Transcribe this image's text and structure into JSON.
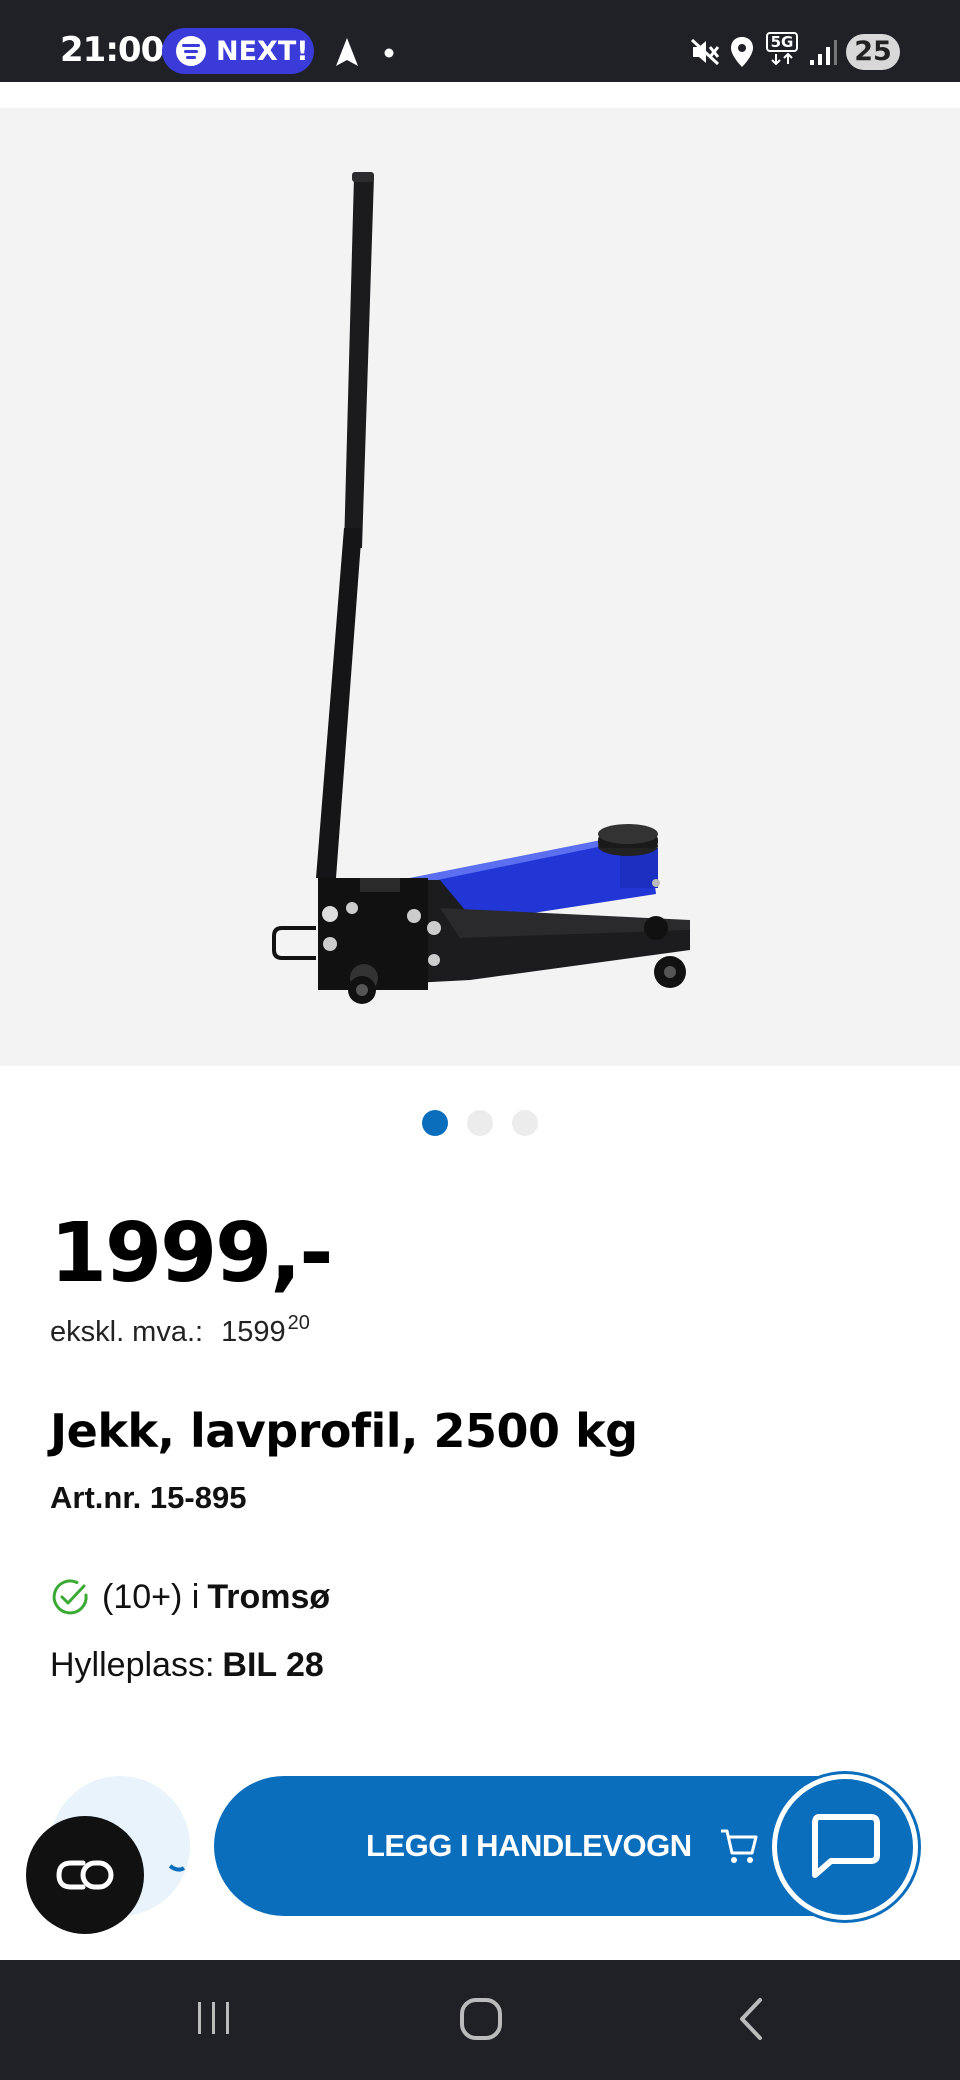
{
  "status_bar": {
    "time": "21:00",
    "music_pill": "NEXT!",
    "network": "5G",
    "battery": "25",
    "icons": [
      "spotify-icon",
      "navigation-icon",
      "dot-icon",
      "mute-icon",
      "location-icon",
      "5g-icon",
      "signal-icon",
      "battery-badge"
    ]
  },
  "gallery": {
    "image_alt": "Jekk, lavprofil, 2500 kg",
    "page_count": 3,
    "active_index": 0
  },
  "product": {
    "price": "1999,-",
    "vat_label": "ekskl. mva.:",
    "vat_whole": "1599",
    "vat_cents": "20",
    "title": "Jekk, lavprofil, 2500 kg",
    "article_number": "Art.nr. 15-895",
    "stock_count": "(10+) i",
    "stock_store": "Tromsø",
    "shelf_label": "Hylleplass:",
    "shelf_value": "BIL 28"
  },
  "actions": {
    "add_to_cart": "LEGG I HANDLEVOGN",
    "icons": [
      "favorite-icon",
      "cart-icon",
      "chat-icon",
      "co-icon"
    ]
  },
  "colors": {
    "accent": "#0a6ebd",
    "status_bar": "#1f2127",
    "pill": "#3a3bd9",
    "in_stock": "#3aaa35"
  },
  "nav": {
    "icons": [
      "recents-icon",
      "home-icon",
      "back-icon"
    ]
  }
}
